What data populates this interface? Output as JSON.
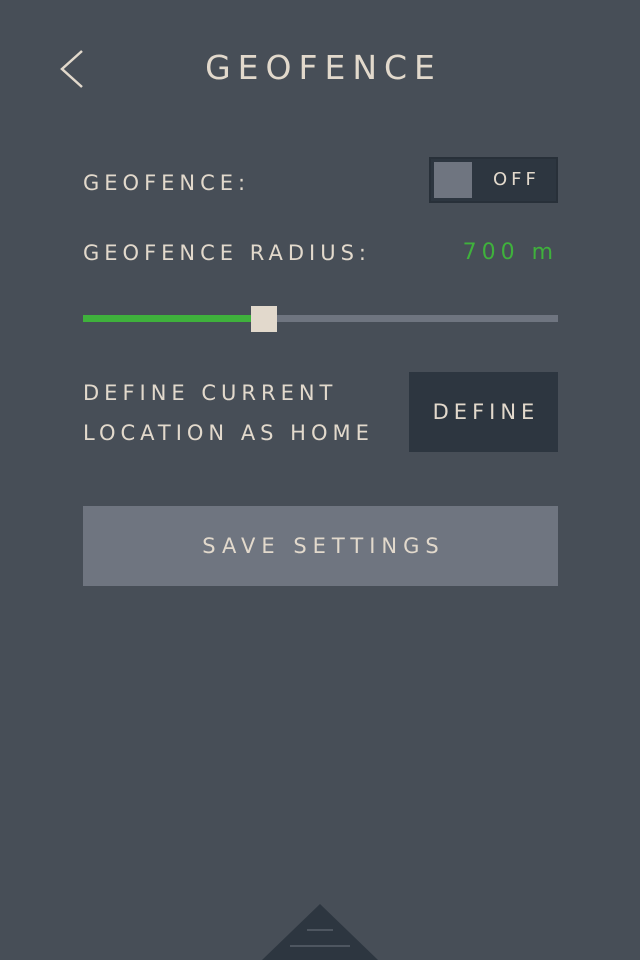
{
  "header": {
    "title": "GEOFENCE",
    "back_icon": "chevron-left-icon"
  },
  "geofence": {
    "label": "GEOFENCE:",
    "toggle_state": "OFF"
  },
  "radius": {
    "label": "GEOFENCE RADIUS:",
    "value": "700 m",
    "slider_fraction": 0.38
  },
  "define": {
    "label_line1": "DEFINE CURRENT",
    "label_line2": "LOCATION AS HOME",
    "button_label": "DEFINE"
  },
  "save": {
    "button_label": "SAVE SETTINGS"
  },
  "bottom_handle_icon": "drawer-handle-icon",
  "colors": {
    "background": "#474e57",
    "text": "#e2d9cc",
    "accent_green": "#3fb13c",
    "button_dark": "#2d3640",
    "button_gray": "#6f7580"
  }
}
